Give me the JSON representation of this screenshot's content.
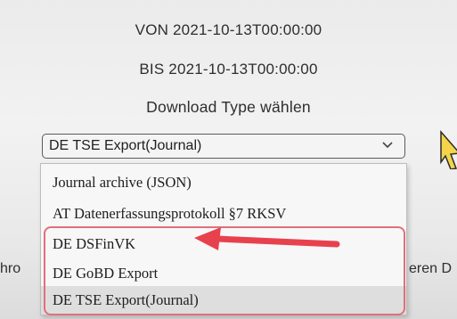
{
  "range": {
    "from_line": "VON 2021-10-13T00:00:00",
    "to_line": "BIS 2021-10-13T00:00:00"
  },
  "download": {
    "label": "Download Type wählen",
    "selected_value": "DE TSE Export(Journal)",
    "options": [
      "Journal archive (JSON)",
      "AT Datenerfassungsprotokoll §7 RKSV",
      "DE DSFinVK",
      "DE GoBD Export",
      "DE TSE Export(Journal)"
    ]
  },
  "background": {
    "left_fragment": "hro",
    "right_fragment": "eren D"
  },
  "annotation": {
    "color": "#e8414e",
    "box_color": "#e0707a"
  },
  "icons": {
    "select_chevron": "chevron-down-icon",
    "cursor": "mouse-pointer-icon",
    "annotation_arrow": "red-arrow-icon"
  }
}
